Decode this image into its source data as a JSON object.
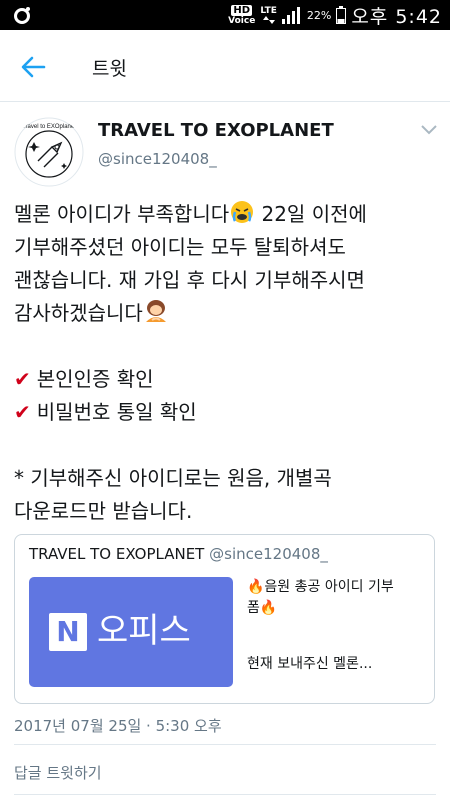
{
  "status_bar": {
    "hd_label": "HD",
    "voice_label": "Voice",
    "network_label": "LTE",
    "battery_percent": "22%",
    "time": "오후 5:42"
  },
  "header": {
    "back_icon": "arrow-left-icon",
    "title": "트윗"
  },
  "tweet": {
    "author_name": "TRAVEL TO EXOPLANET",
    "author_handle": "@since120408_",
    "avatar_text": "Travel to EXOplanet",
    "lines": [
      "멜론 아이디가 부족합니다",
      "22일 이전에",
      "기부해주셨던 아이디는 모두 탈퇴하셔도",
      "괜찮습니다. 재 가입 후 다시 기부해주시면",
      "감사하겠습니다"
    ],
    "checklist": [
      "본인인증 확인",
      "비밀번호 통일 확인"
    ],
    "note_lines": [
      "* 기부해주신 아이디로는 원음, 개별곡",
      "다운로드만 받습니다."
    ],
    "check_mark": "✔",
    "timestamp": "2017년 07월 25일 · 5:30 오후"
  },
  "quote": {
    "author_name": "TRAVEL TO EXOPLANET",
    "author_handle": "@since120408_",
    "thumb_logo": "N",
    "thumb_label": "오피스",
    "text_line1": "🔥음원 총공 아이디 기부",
    "text_line2": "폼🔥",
    "text_more": "현재 보내주신 멜론..."
  },
  "reply": {
    "placeholder": "답글 트윗하기"
  },
  "colors": {
    "accent": "#1da1f2",
    "check": "#d0021b",
    "naver_office": "#6076e1",
    "muted": "#657786"
  }
}
